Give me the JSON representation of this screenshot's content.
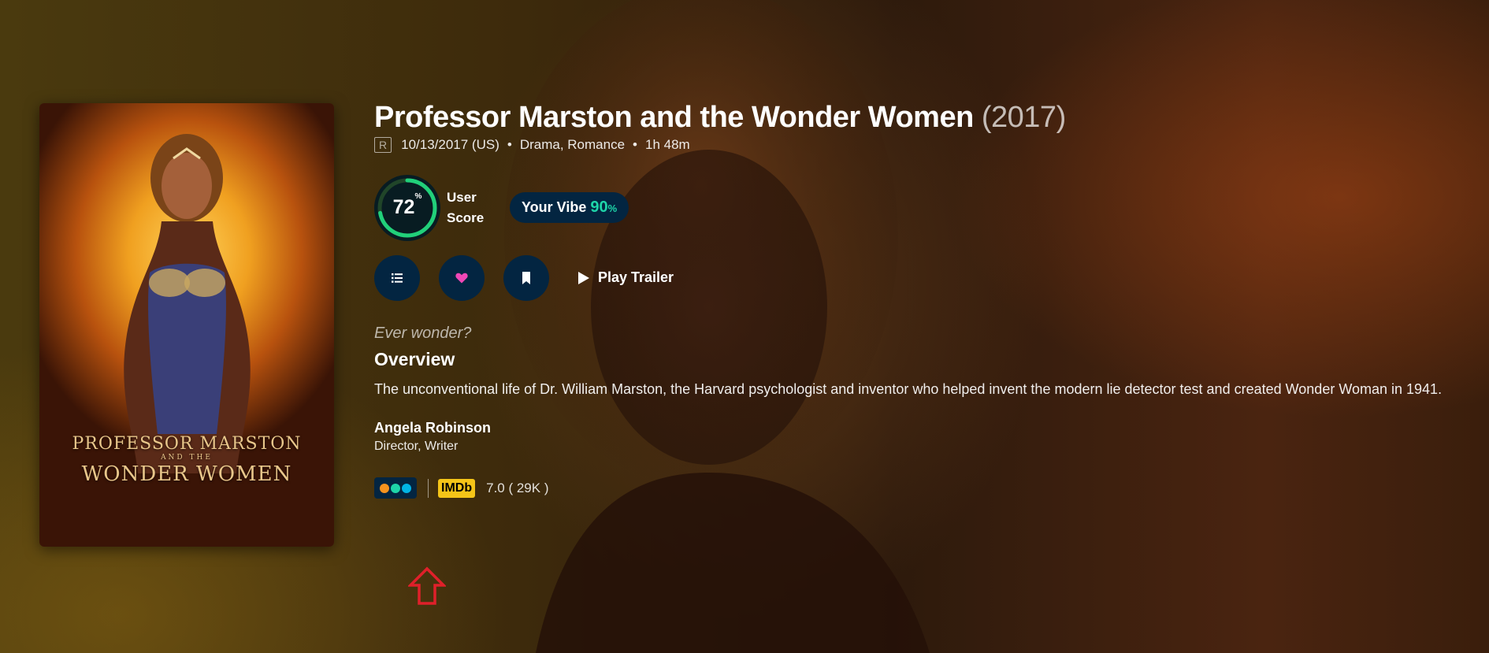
{
  "movie": {
    "title": "Professor Marston and the Wonder Women",
    "year": "(2017)",
    "certification": "R",
    "release": "10/13/2017 (US)",
    "separator": "•",
    "genres": "Drama, Romance",
    "runtime": "1h 48m",
    "poster": {
      "title_line1": "PROFESSOR MARSTON",
      "title_line2": "AND THE",
      "title_line3": "WONDER WOMEN"
    }
  },
  "score": {
    "value": "72",
    "percent_sign": "%",
    "fraction": 0.72,
    "label_line1": "User",
    "label_line2": "Score",
    "ring_color": "#21d07a",
    "ring_track_color": "#204529"
  },
  "vibe": {
    "label": "Your Vibe",
    "value": "90",
    "percent_sign": "%"
  },
  "actions": {
    "list_icon": "list-icon",
    "favorite_icon": "heart-icon",
    "watchlist_icon": "bookmark-icon",
    "trailer_label": "Play Trailer"
  },
  "tagline": "Ever wonder?",
  "overview": {
    "heading": "Overview",
    "text": "The unconventional life of Dr. William Marston, the Harvard psychologist and inventor who helped invent the modern lie detector test and created Wonder Woman in 1941."
  },
  "crew": [
    {
      "name": "Angela Robinson",
      "role": "Director, Writer"
    }
  ],
  "ratings": {
    "vibe_dots": [
      "#f7931e",
      "#1ed5a9",
      "#01b4e4"
    ],
    "imdb_label": "IMDb",
    "imdb_value": "7.0 ( 29K )"
  },
  "colors": {
    "accent_dark": "#032541",
    "heart": "#ef47b6",
    "imdb_yellow": "#f5c518",
    "arrow_red": "#e0202a"
  }
}
